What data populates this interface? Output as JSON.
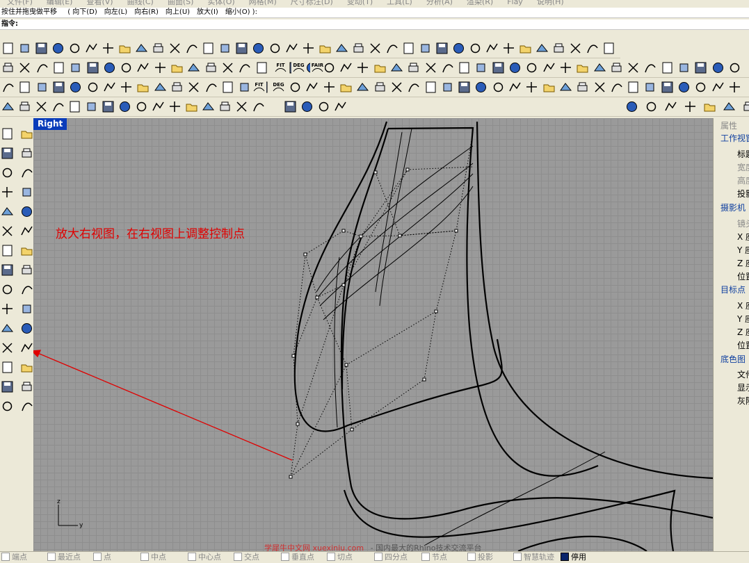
{
  "menu": {
    "items": [
      "文件(F)",
      "编辑(E)",
      "查看(V)",
      "曲线(C)",
      "曲面(S)",
      "实体(O)",
      "网格(M)",
      "尺寸标注(D)",
      "变动(T)",
      "工具(L)",
      "分析(A)",
      "渲染(R)",
      "Flay",
      "说明(H)"
    ]
  },
  "command": {
    "prompt": "按住并拖曳做平移",
    "options": [
      "( 向下(D)",
      "向左(L)",
      "向右(R)",
      "向上(U)",
      "放大(I)",
      "缩小(O) ):"
    ],
    "input_label": "指令:",
    "input_value": ""
  },
  "toolbar_text_icons": {
    "fit": "FIT",
    "deg": "DEG",
    "fair": "FAIR"
  },
  "viewport": {
    "title": "Right",
    "annotation": "放大右视图，在右视图上调整控制点",
    "axis_z": "z",
    "axis_y": "y",
    "watermark_left": "学犀牛中文网 xuexiniu.com",
    "watermark_right": "- 国内最大的Rhino技术交流平台"
  },
  "properties_panel": {
    "title": "属性",
    "rows": [
      {
        "text": "工作视窗",
        "kind": "head"
      },
      {
        "text": "标题",
        "kind": "item"
      },
      {
        "text": "宽度",
        "kind": "dim"
      },
      {
        "text": "高度",
        "kind": "dim"
      },
      {
        "text": "投影",
        "kind": "item"
      },
      {
        "text": "摄影机",
        "kind": "head"
      },
      {
        "text": "镜头",
        "kind": "dim"
      },
      {
        "text": "X 座",
        "kind": "item"
      },
      {
        "text": "Y 座",
        "kind": "item"
      },
      {
        "text": "Z 座",
        "kind": "item"
      },
      {
        "text": "位置",
        "kind": "item"
      },
      {
        "text": "目标点",
        "kind": "head"
      },
      {
        "text": "X 座",
        "kind": "item"
      },
      {
        "text": "Y 座",
        "kind": "item"
      },
      {
        "text": "Z 座",
        "kind": "item"
      },
      {
        "text": "位置",
        "kind": "item"
      },
      {
        "text": "底色图",
        "kind": "head"
      },
      {
        "text": "文件",
        "kind": "item"
      },
      {
        "text": "显示",
        "kind": "item"
      },
      {
        "text": "灰阶",
        "kind": "item"
      }
    ]
  },
  "status": {
    "snaps": [
      {
        "label": "端点",
        "on": false
      },
      {
        "label": "最近点",
        "on": false
      },
      {
        "label": "点",
        "on": false
      },
      {
        "label": "中点",
        "on": false
      },
      {
        "label": "中心点",
        "on": false
      },
      {
        "label": "交点",
        "on": false
      },
      {
        "label": "垂直点",
        "on": false
      },
      {
        "label": "切点",
        "on": false
      },
      {
        "label": "四分点",
        "on": false
      },
      {
        "label": "节点",
        "on": false
      },
      {
        "label": "投影",
        "on": false
      },
      {
        "label": "智慧轨迹",
        "on": false
      },
      {
        "label": "停用",
        "on": true
      }
    ]
  },
  "colors": {
    "viewport_bg": "#9a9a9a",
    "title_bg": "#0a3cba",
    "annotation": "#e00000"
  }
}
